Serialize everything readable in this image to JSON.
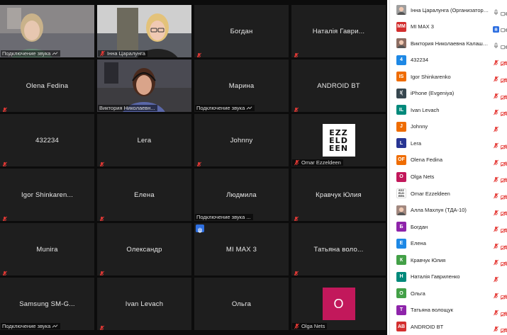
{
  "colors": {
    "tile_bg": "#1e1e1e",
    "active_border": "#c9d44a",
    "muted_red": "#e53935",
    "hand_blue": "#2e6fe0"
  },
  "tiles": [
    {
      "id": "t0",
      "name": "",
      "label": "Подключение звука",
      "video": "woman-1",
      "label_icon": "audio"
    },
    {
      "id": "t1",
      "name": "",
      "label": "Інна Царалунга",
      "video": "woman-2",
      "label_icon": "mic-muted"
    },
    {
      "id": "t2",
      "name": "Богдан",
      "label": "",
      "label_icon": "mic-muted"
    },
    {
      "id": "t3",
      "name": "Наталія Гаври...",
      "label": "",
      "label_icon": "mic-muted"
    },
    {
      "id": "t4",
      "name": "Olena Fedina",
      "label": "",
      "label_icon": "mic-muted"
    },
    {
      "id": "t5",
      "name": "",
      "label": "Виктория Николаевн...",
      "video": "woman-3",
      "active": true,
      "label_icon": ""
    },
    {
      "id": "t6",
      "name": "Марина",
      "label": "Подключение звука",
      "label_icon": "audio"
    },
    {
      "id": "t7",
      "name": "ANDROID BT",
      "label": "",
      "label_icon": "mic-muted"
    },
    {
      "id": "t8",
      "name": "432234",
      "label": "",
      "label_icon": "mic-muted"
    },
    {
      "id": "t9",
      "name": "Lera",
      "label": "",
      "label_icon": "mic-muted"
    },
    {
      "id": "t10",
      "name": "Johnny",
      "label": "",
      "label_icon": "mic-muted"
    },
    {
      "id": "t11",
      "name": "",
      "label": "Omar Ezzeldeen",
      "logo": [
        "EZZ",
        "ELD",
        "EEN"
      ],
      "label_icon": "mic-muted"
    },
    {
      "id": "t12",
      "name": "Igor Shinkaren...",
      "label": "",
      "label_icon": "mic-muted"
    },
    {
      "id": "t13",
      "name": "Елена",
      "label": "",
      "label_icon": "mic-muted"
    },
    {
      "id": "t14",
      "name": "Людмила",
      "label": "Подключение звука ...",
      "label_icon": "none"
    },
    {
      "id": "t15",
      "name": "Кравчук Юлия",
      "label": "",
      "label_icon": "mic-muted"
    },
    {
      "id": "t16",
      "name": "Munira",
      "label": "",
      "label_icon": "mic-muted"
    },
    {
      "id": "t17",
      "name": "Олександр",
      "label": "",
      "label_icon": "mic-muted"
    },
    {
      "id": "t18",
      "name": "MI MAX 3",
      "label": "",
      "hand": true,
      "label_icon": "none"
    },
    {
      "id": "t19",
      "name": "Татьяна воло...",
      "label": "",
      "label_icon": "mic-muted"
    },
    {
      "id": "t20",
      "name": "Samsung SM-G...",
      "label": "Подключение звука",
      "label_icon": "audio"
    },
    {
      "id": "t21",
      "name": "Ivan Levach",
      "label": "",
      "label_icon": "mic-muted"
    },
    {
      "id": "t22",
      "name": "Ольга",
      "label": "",
      "label_icon": "none"
    },
    {
      "id": "t23",
      "name": "",
      "label": "Olga Nets",
      "avatar": {
        "letter": "O",
        "color": "#c2185b"
      },
      "label_icon": "mic-muted"
    }
  ],
  "participants": [
    {
      "name": "Інна Царалунга (Организатор, я)",
      "av": "",
      "color": "#9e9e9e",
      "photo": true,
      "mic": "on",
      "cam": "on"
    },
    {
      "name": "MI MAX 3",
      "av": "MM",
      "color": "#d32f2f",
      "mic": "hand",
      "cam": "on"
    },
    {
      "name": "Виктория Николаевна Калашн...",
      "av": "",
      "color": "#8d6e63",
      "photo": true,
      "mic": "on",
      "cam": "on"
    },
    {
      "name": "432234",
      "av": "4",
      "color": "#1e88e5",
      "mic": "muted",
      "cam": "off"
    },
    {
      "name": "Igor Shinkarenko",
      "av": "IS",
      "color": "#ef6c00",
      "mic": "muted",
      "cam": "off"
    },
    {
      "name": "iPhone (Evgeniya)",
      "av": "I(",
      "color": "#37474f",
      "mic": "muted",
      "cam": "off"
    },
    {
      "name": "Ivan Levach",
      "av": "IL",
      "color": "#00897b",
      "mic": "muted",
      "cam": "off"
    },
    {
      "name": "Johnny",
      "av": "J",
      "color": "#ef6c00",
      "mic": "muted",
      "cam": "none"
    },
    {
      "name": "Lera",
      "av": "L",
      "color": "#283593",
      "mic": "muted",
      "cam": "off"
    },
    {
      "name": "Olena Fedina",
      "av": "OF",
      "color": "#ef6c00",
      "mic": "muted",
      "cam": "off"
    },
    {
      "name": "Olga Nets",
      "av": "O",
      "color": "#c2185b",
      "mic": "muted",
      "cam": "off"
    },
    {
      "name": "Omar Ezzeldeen",
      "av": "EZZ",
      "color": "#ffffff",
      "logo": true,
      "mic": "muted",
      "cam": "off"
    },
    {
      "name": "Алла Махлун (ТДА-10)",
      "av": "",
      "color": "#a1887f",
      "photo": true,
      "mic": "muted",
      "cam": "off"
    },
    {
      "name": "Богдан",
      "av": "Б",
      "color": "#8e24aa",
      "mic": "muted",
      "cam": "off"
    },
    {
      "name": "Елена",
      "av": "Е",
      "color": "#1e88e5",
      "mic": "muted",
      "cam": "off"
    },
    {
      "name": "Кравчук Юлия",
      "av": "К",
      "color": "#43a047",
      "mic": "muted",
      "cam": "off"
    },
    {
      "name": "Наталія Гавриленко",
      "av": "Н",
      "color": "#00897b",
      "mic": "muted",
      "cam": "none"
    },
    {
      "name": "Ольга",
      "av": "О",
      "color": "#43a047",
      "mic": "muted",
      "cam": "off"
    },
    {
      "name": "Татьяна волощук",
      "av": "Т",
      "color": "#8e24aa",
      "mic": "muted",
      "cam": "off"
    },
    {
      "name": "ANDROID BT",
      "av": "AB",
      "color": "#d32f2f",
      "mic": "muted",
      "cam": "off"
    }
  ]
}
